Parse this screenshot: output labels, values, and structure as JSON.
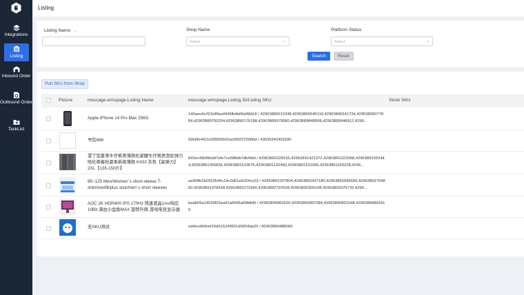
{
  "sidebar": {
    "items": [
      {
        "label": "Integrations",
        "icon": "layers-icon"
      },
      {
        "label": "Listing",
        "icon": "listing-icon",
        "active": true
      },
      {
        "label": "Inbound Order",
        "icon": "inbound-icon"
      },
      {
        "label": "Outbound Order",
        "icon": "outbound-icon"
      },
      {
        "label": "TaskList",
        "icon": "folder-icon"
      }
    ]
  },
  "header": {
    "title": "Listing"
  },
  "filters": {
    "listing_name_label": "Listing Name",
    "shop_name_label": "Shop Name",
    "shop_name_placeholder": "Select",
    "platform_status_label": "Platform Status",
    "platform_status_placeholder": "Select",
    "search_label": "Search",
    "reset_label": "Reset"
  },
  "table": {
    "pull_sku_label": "Pull SKU from Shop",
    "columns": {
      "picture": "Picture",
      "listing_name": "message.wmspage.Listing Name",
      "listing_id": "message.wmspage.Listing ID/Listing SKU",
      "stock_sku": "Stock SKU"
    },
    "rows": [
      {
        "name": "Apple iPhone 14 Pro Max 256G",
        "sku": "140aee9c021b85eef446fb4b06d48d18 / 42963890012348,42963890045116,42963890241724,42963890077884,42963889750204,42963890176188,42963889979580,42963889848508,42963889946812,4296..."
      },
      {
        "name": "书包666",
        "sku": "59b0fe4011b28956602ae55f2270006d / 43039242453180"
      },
      {
        "name": "望了型夏季牛仔裤男薄款松紧腰牛仔裤男宽松弹力哈伦裤春秋夏季新款薄款 K433 灰色【高弹力】 2XL【135-150斤】",
        "sku": "843ec49bf0bdd7efe7ce688db7db4fdd / 42963891028156,42963891421372,42963891323068,42963891552444,42963891355836,42963891519676,42963891126460,42963891191996,42963891159228,4296..."
      },
      {
        "name": "95~125 Men/Women`s short-sleeve T-shirt/overfit/plus size/men`s short sleeves",
        "sku": "aa408b2b2923546c14c2d01e6324cc03 / 42963892207804,42963892437180,42963892666556,42963892764860,42963891978428,42963892273340,42963892797628,42963892306108,42963892076732,4296..."
      },
      {
        "name": "AOC 2K HDR400 IPS 170Hz 快速液晶1ms响应 10Bit 满血小金刚MAX 旋转升降 游戏电竞显示器",
        "sku": "badb09a14539f23ea91a5696af08dbf6 / 42963890962620,42963890897084,42963890831548,42963890864316"
      },
      {
        "name": "无SKU测试",
        "sku": "ed4ecd94eef16d015249551d5834da20 / 42963889488060"
      }
    ]
  }
}
